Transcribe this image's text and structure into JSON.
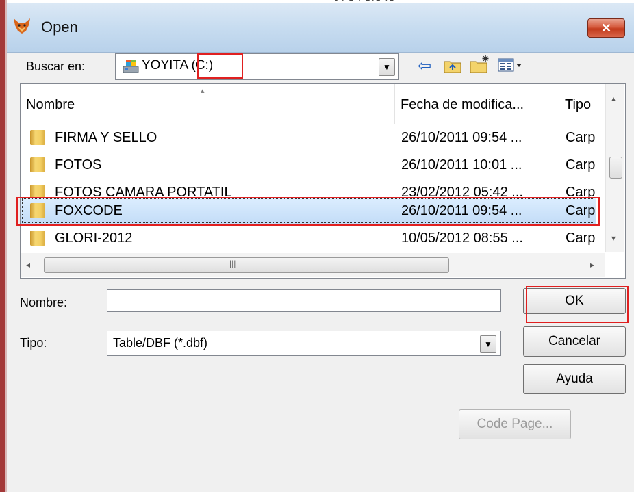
{
  "window": {
    "title": "Open",
    "close_label": "✕",
    "background_strip_text": "▸▾ ▴ ▾ ▴▾▴ ▾▴"
  },
  "lookin": {
    "label": "Buscar en:",
    "value": "YOYITA (C:)",
    "dropdown_icon": "▼"
  },
  "toolbar": {
    "back_icon": "⇦",
    "up_folder_icon": "⬚",
    "new_folder_icon": "✱",
    "view_menu_icon": "▦▾"
  },
  "list": {
    "columns": [
      "Nombre",
      "Fecha de modifica...",
      "Tipo"
    ],
    "sort_indicator": "▴",
    "rows": [
      {
        "name": "FIRMA Y SELLO",
        "date": "26/10/2011 09:54 ...",
        "type": "Carpe"
      },
      {
        "name": "FOTOS",
        "date": "26/10/2011 10:01 ...",
        "type": "Carpe"
      },
      {
        "name": "FOTOS CAMARA PORTATIL",
        "date": "23/02/2012 05:42 ...",
        "type": "Carpe"
      },
      {
        "name": "FOXCODE",
        "date": "26/10/2011 09:54 ...",
        "type": "Carpe"
      },
      {
        "name": "GLORI-2012",
        "date": "10/05/2012 08:55 ...",
        "type": "Carpe"
      }
    ],
    "selected_index": 3,
    "scroll": {
      "up": "▴",
      "down": "▾",
      "left": "◂",
      "right": "▸",
      "grip": "|||"
    }
  },
  "form": {
    "name_label": "Nombre:",
    "name_value": "",
    "type_label": "Tipo:",
    "type_value": "Table/DBF (*.dbf)"
  },
  "buttons": {
    "ok": "OK",
    "cancel": "Cancelar",
    "help": "Ayuda",
    "code_page": "Code Page..."
  },
  "colors": {
    "highlight_box": "#e02020",
    "selection": "#c2dcf7",
    "title_bar": "#c7dcf0"
  }
}
